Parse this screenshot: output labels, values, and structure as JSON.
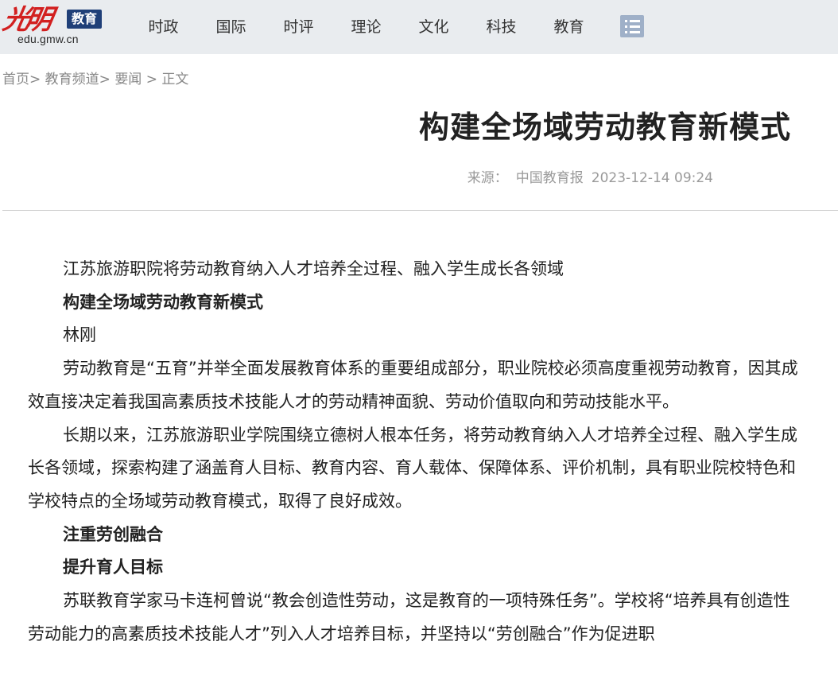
{
  "header": {
    "logo_brush": "光明",
    "logo_badge": "教育",
    "logo_domain": "edu.gmw.cn",
    "nav": [
      "时政",
      "国际",
      "时评",
      "理论",
      "文化",
      "科技",
      "教育"
    ]
  },
  "breadcrumb": {
    "home": "首页",
    "sep1": ">",
    "channel": "教育频道",
    "sep2": ">",
    "section": "要闻",
    "sep3": " > ",
    "current": "正文"
  },
  "article": {
    "title": "构建全场域劳动教育新模式",
    "source_label": "来源：",
    "source": "中国教育报",
    "datetime": "2023-12-14 09:24",
    "paragraphs": [
      {
        "text": "江苏旅游职院将劳动教育纳入人才培养全过程、融入学生成长各领域",
        "bold": false
      },
      {
        "text": "构建全场域劳动教育新模式",
        "bold": true
      },
      {
        "text": "林刚",
        "bold": false
      },
      {
        "text": "劳动教育是“五育”并举全面发展教育体系的重要组成部分，职业院校必须高度重视劳动教育，因其成效直接决定着我国高素质技术技能人才的劳动精神面貌、劳动价值取向和劳动技能水平。",
        "bold": false
      },
      {
        "text": "长期以来，江苏旅游职业学院围绕立德树人根本任务，将劳动教育纳入人才培养全过程、融入学生成长各领域，探索构建了涵盖育人目标、教育内容、育人载体、保障体系、评价机制，具有职业院校特色和学校特点的全场域劳动教育模式，取得了良好成效。",
        "bold": false
      },
      {
        "text": "注重劳创融合",
        "bold": true
      },
      {
        "text": "提升育人目标",
        "bold": true
      },
      {
        "text": "苏联教育学家马卡连柯曾说“教会创造性劳动，这是教育的一项特殊任务”。学校将“培养具有创造性劳动能力的高素质技术技能人才”列入人才培养目标，并坚持以“劳创融合”作为促进职",
        "bold": false
      }
    ]
  }
}
